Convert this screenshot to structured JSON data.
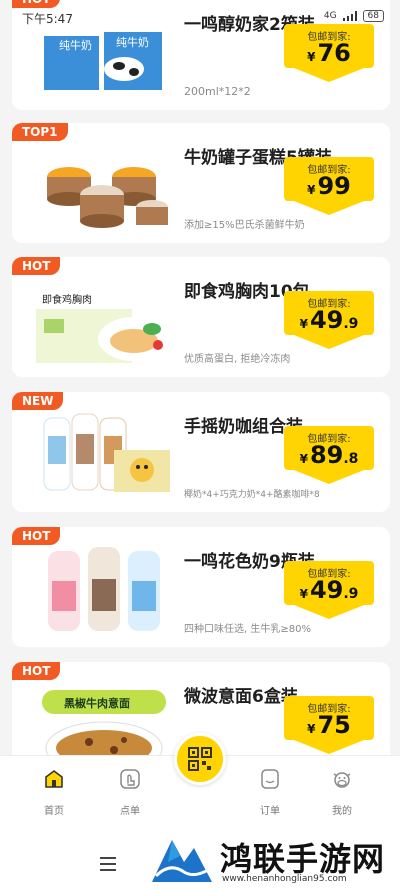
{
  "status_bar": {
    "time": "下午5:47",
    "network": "4G",
    "battery": "68"
  },
  "products": [
    {
      "badge": "HOT",
      "title": "一鸣醇奶家2箱装",
      "subtitle": "200ml*12*2",
      "price_label": "包邮到家:",
      "currency": "¥",
      "price_int": "76",
      "price_dec": ""
    },
    {
      "badge": "TOP1",
      "title": "牛奶罐子蛋糕5罐装",
      "subtitle": "添加≥15%巴氏杀菌鲜牛奶",
      "price_label": "包邮到家:",
      "currency": "¥",
      "price_int": "99",
      "price_dec": ""
    },
    {
      "badge": "HOT",
      "title": "即食鸡胸肉10包",
      "subtitle": "优质高蛋白, 拒绝冷冻肉",
      "price_label": "包邮到家:",
      "currency": "¥",
      "price_int": "49",
      "price_dec": ".9"
    },
    {
      "badge": "NEW",
      "title": "手摇奶咖组合装",
      "subtitle": "椰奶*4+巧克力奶*4+酪素咖啡*8",
      "price_label": "包邮到家:",
      "currency": "¥",
      "price_int": "89",
      "price_dec": ".8"
    },
    {
      "badge": "HOT",
      "title": "一鸣花色奶9瓶装",
      "subtitle": "四种口味任选, 生牛乳≥80%",
      "price_label": "包邮到家:",
      "currency": "¥",
      "price_int": "49",
      "price_dec": ".9"
    },
    {
      "badge": "HOT",
      "title": "微波意面6盒装",
      "subtitle": "",
      "price_label": "包邮到家:",
      "currency": "¥",
      "price_int": "75",
      "price_dec": ""
    }
  ],
  "product_images": {
    "milk_box": "纯牛奶",
    "chicken": "即食鸡胸肉",
    "pasta": "黑椒牛肉意面"
  },
  "tabbar": {
    "home": "首页",
    "order_food": "点单",
    "orders": "订单",
    "mine": "我的"
  },
  "watermark": {
    "text": "鸿联手游网",
    "url": "www.henanhonglian95.com"
  },
  "colors": {
    "accent": "#ffd400",
    "badge": "#f15a22"
  }
}
